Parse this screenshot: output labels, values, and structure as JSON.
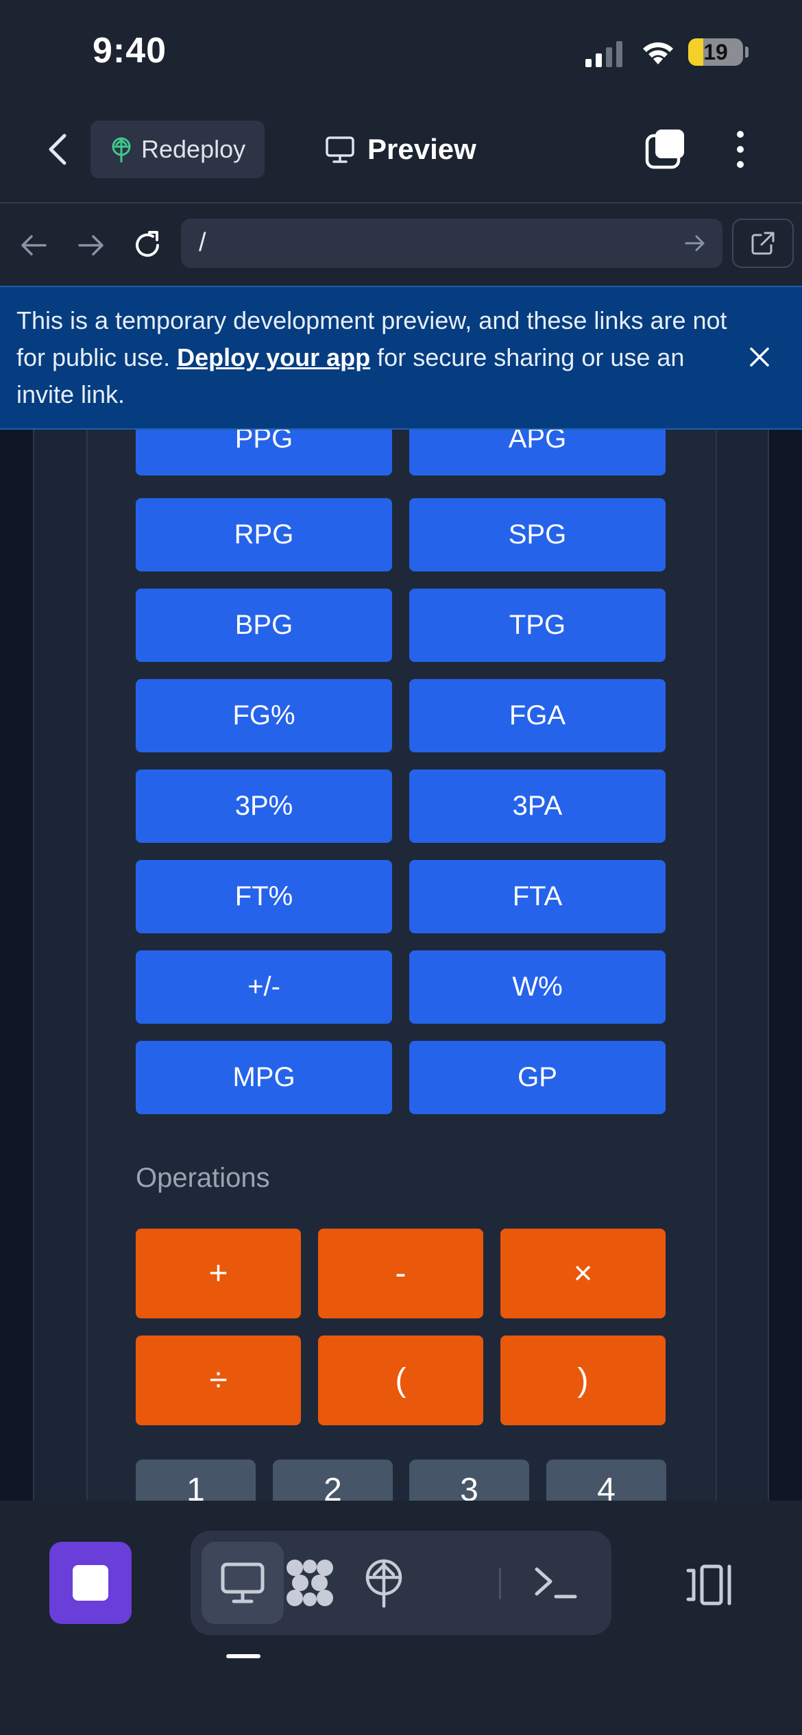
{
  "status_bar": {
    "time": "9:40",
    "battery": "19"
  },
  "toolbar": {
    "redeploy_label": "Redeploy",
    "preview_label": "Preview"
  },
  "urlbar": {
    "url": "/"
  },
  "banner": {
    "text_before": "This is a temporary development preview, and these links are not for public use. ",
    "link_text": "Deploy your app",
    "text_after": " for secure sharing or use an invite link."
  },
  "stats": {
    "buttons": [
      "PPG",
      "APG",
      "RPG",
      "SPG",
      "BPG",
      "TPG",
      "FG%",
      "FGA",
      "3P%",
      "3PA",
      "FT%",
      "FTA",
      "+/-",
      "W%",
      "MPG",
      "GP"
    ]
  },
  "operations": {
    "label": "Operations",
    "buttons": [
      "+",
      "-",
      "×",
      "÷",
      "(",
      ")"
    ]
  },
  "numbers": {
    "buttons": [
      "1",
      "2",
      "3",
      "4"
    ]
  },
  "colors": {
    "stat_button": "#2563eb",
    "operation_button": "#ea580c",
    "number_button": "#475569",
    "banner": "#053d80",
    "stop_button": "#6a3ed8"
  },
  "icons": {
    "toolbar": [
      "chevron-left-icon",
      "redeploy-icon",
      "monitor-icon",
      "tabs-icon",
      "more-vertical-icon"
    ],
    "urlbar": [
      "arrow-left-icon",
      "arrow-right-icon",
      "reload-icon",
      "go-arrow-icon",
      "open-external-icon"
    ],
    "banner": [
      "close-icon"
    ],
    "bottom": [
      "stop-icon",
      "monitor-icon",
      "workflow-icon",
      "deploy-icon",
      "terminal-icon",
      "side-panel-icon"
    ]
  }
}
